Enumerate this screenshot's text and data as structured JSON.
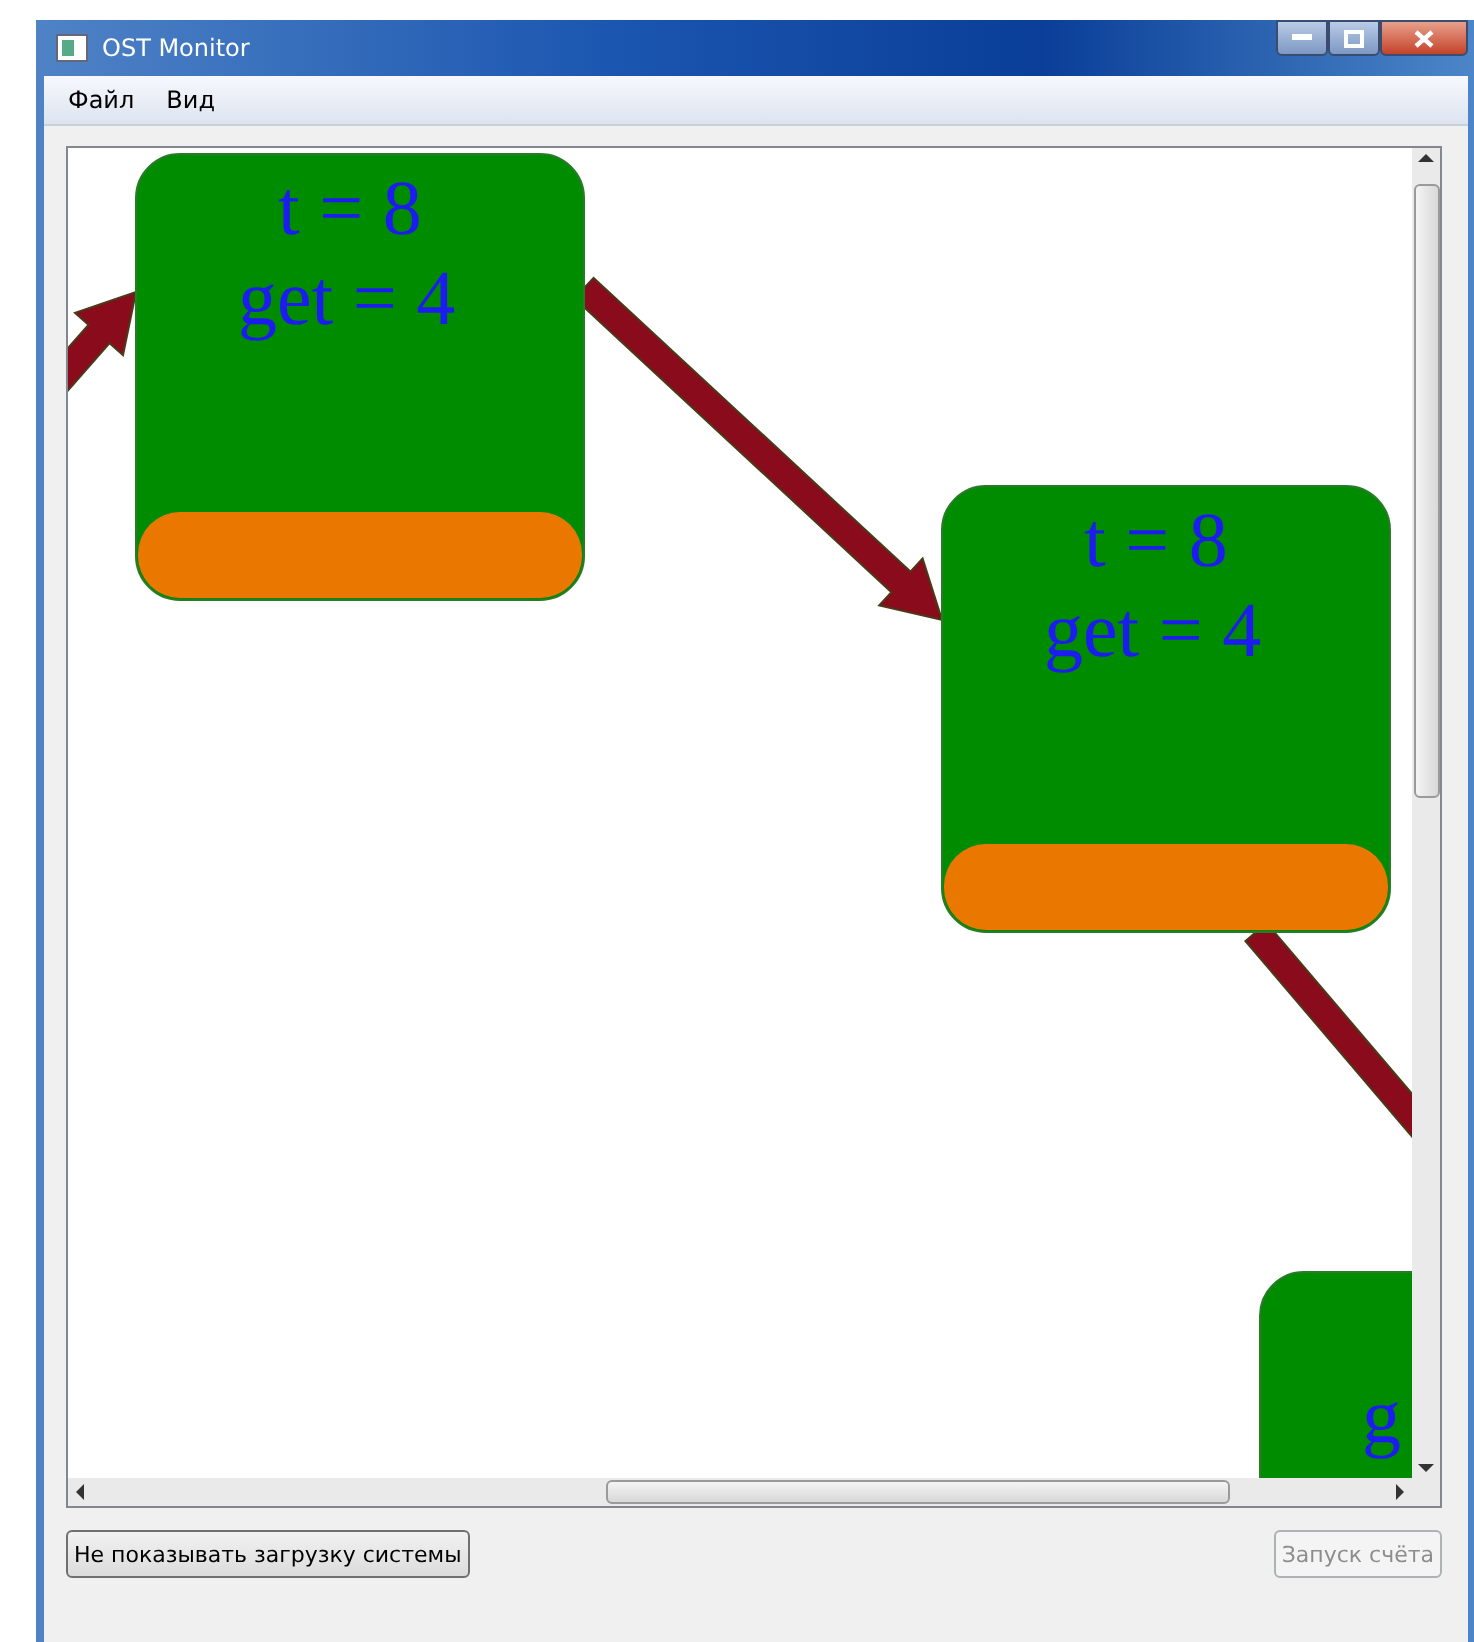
{
  "window": {
    "title": "OST Monitor"
  },
  "menu": [
    {
      "label": "Файл"
    },
    {
      "label": "Вид"
    }
  ],
  "canvas": {
    "nodes": [
      {
        "time": "t = 8",
        "get": "get = 4"
      },
      {
        "time": "t = 8",
        "get": "get = 4"
      },
      {
        "get": "g"
      }
    ]
  },
  "buttons": [
    {
      "label": "Не показывать загрузку системы",
      "disabled": false
    },
    {
      "label": "Запуск счёта",
      "disabled": true
    }
  ]
}
